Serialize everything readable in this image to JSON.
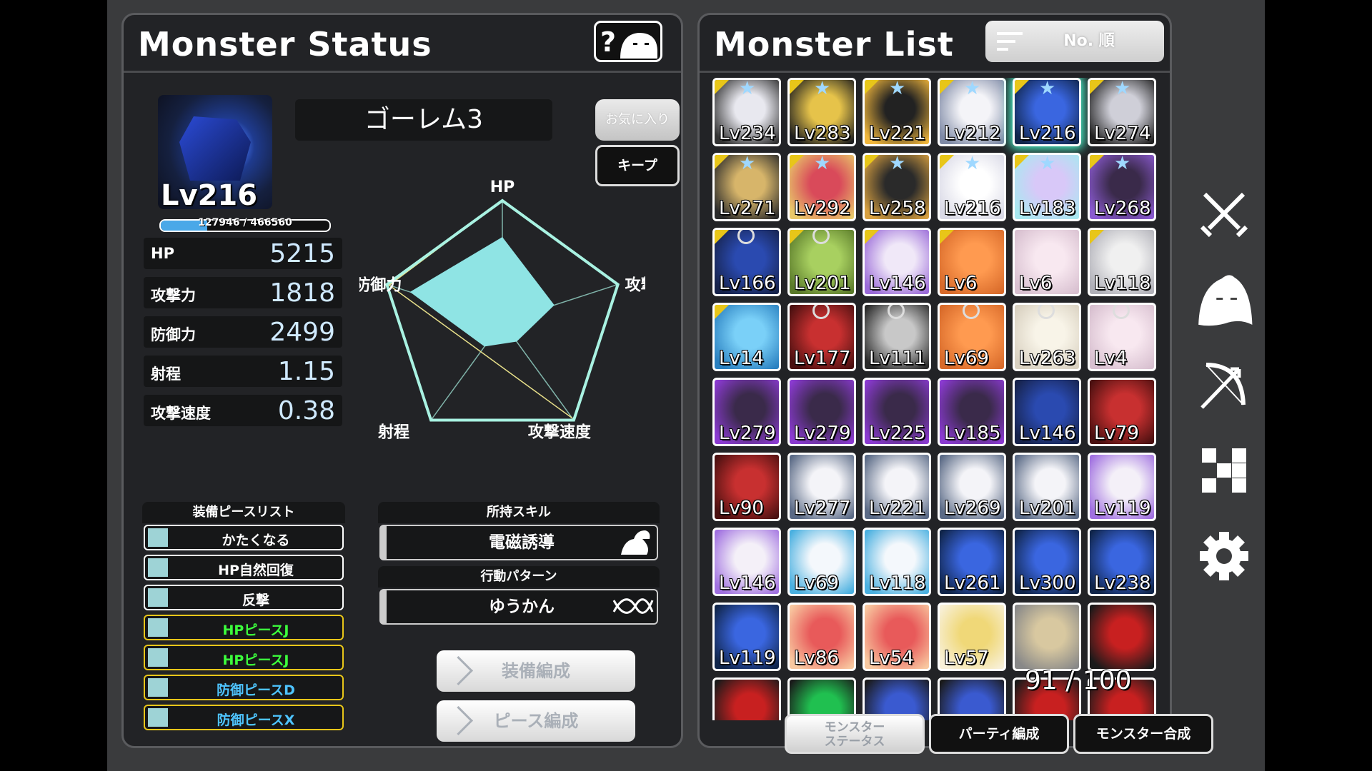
{
  "status_panel": {
    "title": "Monster Status",
    "monster_name": "ゴーレム3",
    "level": "Lv216",
    "exp_text": "127946 / 466560",
    "exp_progress": 0.274,
    "favorite_label": "お気に入り",
    "keep_label": "キープ",
    "stats": [
      {
        "label": "HP",
        "value": "5215"
      },
      {
        "label": "攻撃力",
        "value": "1818"
      },
      {
        "label": "防御力",
        "value": "2499"
      },
      {
        "label": "射程",
        "value": "1.15"
      },
      {
        "label": "攻撃速度",
        "value": "0.38"
      }
    ],
    "radar": {
      "axes": [
        "HP",
        "攻撃力",
        "攻撃速度",
        "射程",
        "防御力"
      ],
      "values": [
        0.7,
        0.45,
        0.2,
        0.25,
        0.8
      ],
      "fill_color": "#8fe4e4",
      "outline_color": "#a9f2e2",
      "compare_color": "#e8e08a"
    },
    "equip_list": {
      "heading": "装備ピースリスト",
      "items": [
        {
          "label": "かたくなる",
          "color": "#ffffff"
        },
        {
          "label": "HP自然回復",
          "color": "#ffffff"
        },
        {
          "label": "反撃",
          "color": "#ffffff"
        },
        {
          "label": "HPピースJ",
          "color": "#3cff3c"
        },
        {
          "label": "HPピースJ",
          "color": "#3cff3c"
        },
        {
          "label": "防御ピースD",
          "color": "#4ec4ff"
        },
        {
          "label": "防御ピースX",
          "color": "#4ec4ff"
        }
      ]
    },
    "skill": {
      "heading": "所持スキル",
      "value": "電磁誘導"
    },
    "behavior": {
      "heading": "行動パターン",
      "value": "ゆうかん"
    },
    "buttons": {
      "equip_edit": "装備編成",
      "piece_edit": "ピース編成"
    }
  },
  "list_panel": {
    "title": "Monster List",
    "sort_label": "No. 順",
    "count_text": "91 / 100",
    "monsters": [
      {
        "level": "Lv234",
        "mark": "star",
        "badge": true,
        "c1": "#e8e8ef",
        "c2": "#333"
      },
      {
        "level": "Lv283",
        "mark": "star",
        "badge": true,
        "c1": "#e6c34a",
        "c2": "#1f1f1f"
      },
      {
        "level": "Lv221",
        "mark": "star",
        "badge": true,
        "c1": "#222",
        "c2": "#f0b63c"
      },
      {
        "level": "Lv212",
        "mark": "star",
        "badge": true,
        "c1": "#f4f4f8",
        "c2": "#7f8aa6"
      },
      {
        "level": "Lv216",
        "mark": "star",
        "badge": true,
        "c1": "#3a66e0",
        "c2": "#10254a",
        "selected": true
      },
      {
        "level": "Lv274",
        "mark": "star",
        "badge": true,
        "c1": "#cfcfd8",
        "c2": "#222"
      },
      {
        "level": "Lv271",
        "mark": "star",
        "badge": true,
        "c1": "#d7b56a",
        "c2": "#2a2a2a"
      },
      {
        "level": "Lv292",
        "mark": "star",
        "badge": true,
        "c1": "#d94a5a",
        "c2": "#e8c86a"
      },
      {
        "level": "Lv258",
        "mark": "star",
        "badge": true,
        "c1": "#2a2a2a",
        "c2": "#d8a040"
      },
      {
        "level": "Lv216",
        "mark": "star",
        "badge": true,
        "c1": "#ffffff",
        "c2": "#d9d9e6"
      },
      {
        "level": "Lv183",
        "mark": "star",
        "badge": true,
        "c1": "#d8c8f8",
        "c2": "#a8e8f0"
      },
      {
        "level": "Lv268",
        "mark": "star",
        "badge": true,
        "c1": "#3a2a4a",
        "c2": "#8a5ad0"
      },
      {
        "level": "Lv166",
        "mark": "lock",
        "badge": true,
        "c1": "#2a4ab0",
        "c2": "#16224a"
      },
      {
        "level": "Lv201",
        "mark": "lock",
        "badge": true,
        "c1": "#a8d060",
        "c2": "#5a7a2a"
      },
      {
        "level": "Lv146",
        "mark": "",
        "badge": true,
        "c1": "#f0e8f8",
        "c2": "#9a6ad8"
      },
      {
        "level": "Lv6",
        "mark": "",
        "badge": true,
        "c1": "#ff9a50",
        "c2": "#d86a2a"
      },
      {
        "level": "Lv6",
        "mark": "",
        "badge": false,
        "c1": "#f8e8f0",
        "c2": "#d8c0d0"
      },
      {
        "level": "Lv118",
        "mark": "",
        "badge": true,
        "c1": "#f0f0f0",
        "c2": "#b0b0b8"
      },
      {
        "level": "Lv14",
        "mark": "",
        "badge": true,
        "c1": "#7ad0f8",
        "c2": "#2a80c0"
      },
      {
        "level": "Lv177",
        "mark": "lock",
        "badge": false,
        "c1": "#c83030",
        "c2": "#4a1010"
      },
      {
        "level": "Lv111",
        "mark": "lock",
        "badge": false,
        "c1": "#c8c8c8",
        "c2": "#2a2a2a"
      },
      {
        "level": "Lv69",
        "mark": "lock",
        "badge": false,
        "c1": "#ff9a50",
        "c2": "#d86a2a"
      },
      {
        "level": "Lv263",
        "mark": "lock",
        "badge": false,
        "c1": "#f8f4e8",
        "c2": "#d8d0c0"
      },
      {
        "level": "Lv4",
        "mark": "lock",
        "badge": false,
        "c1": "#f8e8f0",
        "c2": "#d8c0d0"
      },
      {
        "level": "Lv279",
        "mark": "",
        "badge": false,
        "c1": "#3a2a4a",
        "c2": "#8a3ad0"
      },
      {
        "level": "Lv279",
        "mark": "",
        "badge": false,
        "c1": "#3a2a4a",
        "c2": "#8a3ad0"
      },
      {
        "level": "Lv225",
        "mark": "",
        "badge": false,
        "c1": "#3a2a4a",
        "c2": "#8a3ad0"
      },
      {
        "level": "Lv185",
        "mark": "",
        "badge": false,
        "c1": "#3a2a4a",
        "c2": "#8a3ad0"
      },
      {
        "level": "Lv146",
        "mark": "",
        "badge": false,
        "c1": "#2a4ab0",
        "c2": "#16224a"
      },
      {
        "level": "Lv79",
        "mark": "",
        "badge": false,
        "c1": "#c83030",
        "c2": "#4a1010"
      },
      {
        "level": "Lv90",
        "mark": "",
        "badge": false,
        "c1": "#c83030",
        "c2": "#4a1010"
      },
      {
        "level": "Lv277",
        "mark": "",
        "badge": false,
        "c1": "#f4f4f8",
        "c2": "#5a6a86"
      },
      {
        "level": "Lv221",
        "mark": "",
        "badge": false,
        "c1": "#f4f4f8",
        "c2": "#5a6a86"
      },
      {
        "level": "Lv269",
        "mark": "",
        "badge": false,
        "c1": "#f4f4f8",
        "c2": "#5a6a86"
      },
      {
        "level": "Lv201",
        "mark": "",
        "badge": false,
        "c1": "#f4f4f8",
        "c2": "#5a6a86"
      },
      {
        "level": "Lv119",
        "mark": "",
        "badge": false,
        "c1": "#f4f0f8",
        "c2": "#a070e0"
      },
      {
        "level": "Lv146",
        "mark": "",
        "badge": false,
        "c1": "#f4f0f8",
        "c2": "#a070e0"
      },
      {
        "level": "Lv69",
        "mark": "",
        "badge": false,
        "c1": "#f4f8fc",
        "c2": "#4ab0e0"
      },
      {
        "level": "Lv118",
        "mark": "",
        "badge": false,
        "c1": "#f4f8fc",
        "c2": "#4ab0e0"
      },
      {
        "level": "Lv261",
        "mark": "",
        "badge": false,
        "c1": "#3a66e0",
        "c2": "#10254a"
      },
      {
        "level": "Lv300",
        "mark": "",
        "badge": false,
        "c1": "#3a66e0",
        "c2": "#10254a"
      },
      {
        "level": "Lv238",
        "mark": "",
        "badge": false,
        "c1": "#3a66e0",
        "c2": "#10254a"
      },
      {
        "level": "Lv119",
        "mark": "",
        "badge": false,
        "c1": "#3a66e0",
        "c2": "#10254a"
      },
      {
        "level": "Lv86",
        "mark": "",
        "badge": false,
        "c1": "#e85a5a",
        "c2": "#f8c8a0"
      },
      {
        "level": "Lv54",
        "mark": "",
        "badge": false,
        "c1": "#e85a5a",
        "c2": "#f8c8a0"
      },
      {
        "level": "Lv57",
        "mark": "",
        "badge": false,
        "c1": "#f0d878",
        "c2": "#f8f0d8"
      },
      {
        "level": "",
        "mark": "",
        "badge": false,
        "c1": "#d8c8a0",
        "c2": "#888"
      },
      {
        "level": "",
        "mark": "",
        "badge": false,
        "c1": "#c82020",
        "c2": "#1a1a1a"
      },
      {
        "level": "",
        "mark": "",
        "badge": false,
        "c1": "#c82020",
        "c2": "#1a1a1a"
      },
      {
        "level": "",
        "mark": "",
        "badge": false,
        "c1": "#20c050",
        "c2": "#1a1a1a"
      },
      {
        "level": "",
        "mark": "",
        "badge": false,
        "c1": "#3a5ad0",
        "c2": "#1a1a1a"
      },
      {
        "level": "",
        "mark": "",
        "badge": false,
        "c1": "#3a5ad0",
        "c2": "#1a1a1a"
      },
      {
        "level": "",
        "mark": "",
        "badge": false,
        "c1": "#c82020",
        "c2": "#1a1a1a"
      },
      {
        "level": "",
        "mark": "",
        "badge": false,
        "c1": "#c82020",
        "c2": "#1a1a1a"
      }
    ]
  },
  "bottom_tabs": [
    {
      "label": "モンスター\nステータス",
      "active": true
    },
    {
      "label": "パーティ編成",
      "active": false
    },
    {
      "label": "モンスター合成",
      "active": false
    }
  ],
  "side_menu": [
    "crossed-swords-icon",
    "ghost-icon",
    "bow-icon",
    "puzzle-piece-icon",
    "gear-icon"
  ]
}
